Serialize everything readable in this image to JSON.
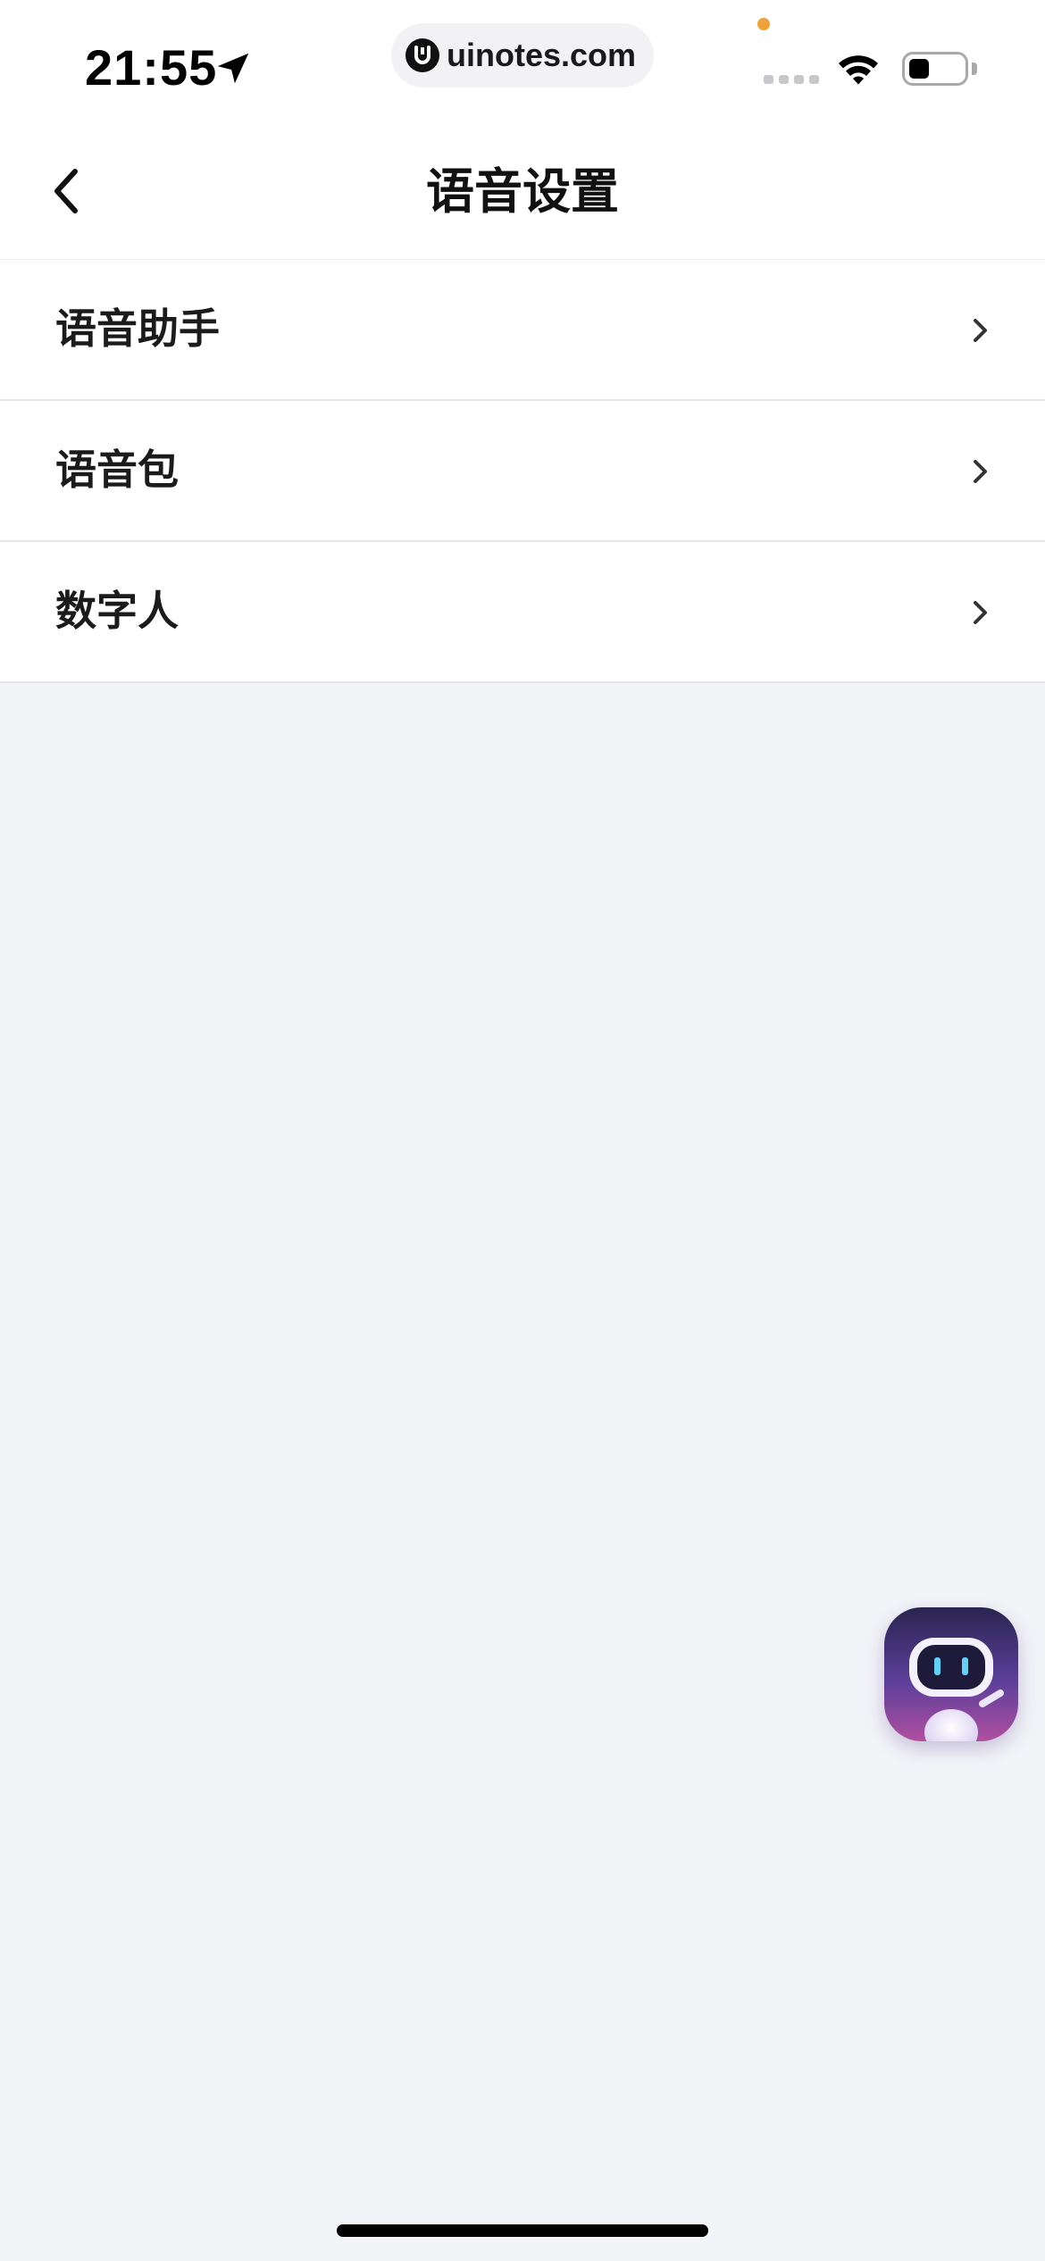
{
  "status_bar": {
    "time": "21:55",
    "url": "uinotes.com"
  },
  "header": {
    "title": "语音设置"
  },
  "menu": {
    "items": [
      {
        "label": "语音助手"
      },
      {
        "label": "语音包"
      },
      {
        "label": "数字人"
      }
    ]
  },
  "icons": {
    "back": "chevron-left-icon",
    "row_arrow": "chevron-right-icon",
    "location": "location-arrow-icon",
    "wifi": "wifi-icon",
    "battery": "battery-icon",
    "assistant": "robot-assistant-icon"
  },
  "colors": {
    "page_background": "#f3f4f8",
    "surface": "#ffffff",
    "divider": "#e6e6ea",
    "text_primary": "#1b1b1b",
    "notification_dot": "#f0a23a",
    "assistant_gradient_start": "#2a2450",
    "assistant_gradient_end": "#b04fa0"
  }
}
